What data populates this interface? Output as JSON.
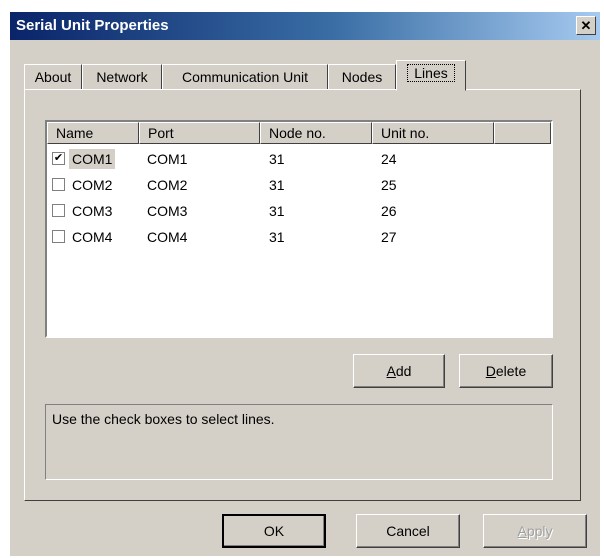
{
  "window": {
    "title": "Serial Unit Properties",
    "close_glyph": "✕"
  },
  "tabs": [
    {
      "label": "About"
    },
    {
      "label": "Network"
    },
    {
      "label": "Communication Unit"
    },
    {
      "label": "Nodes"
    },
    {
      "label": "Lines",
      "active": true
    }
  ],
  "list": {
    "columns": [
      "Name",
      "Port",
      "Node no.",
      "Unit no."
    ],
    "rows": [
      {
        "name": "COM1",
        "port": "COM1",
        "node": "31",
        "unit": "24",
        "checked": true,
        "check_glyph": "✔"
      },
      {
        "name": "COM2",
        "port": "COM2",
        "node": "31",
        "unit": "25",
        "checked": false,
        "check_glyph": ""
      },
      {
        "name": "COM3",
        "port": "COM3",
        "node": "31",
        "unit": "26",
        "checked": false,
        "check_glyph": ""
      },
      {
        "name": "COM4",
        "port": "COM4",
        "node": "31",
        "unit": "27",
        "checked": false,
        "check_glyph": ""
      }
    ]
  },
  "buttons": {
    "add_hotkey": "A",
    "add_rest": "dd",
    "delete_hotkey": "D",
    "delete_rest": "elete"
  },
  "info": {
    "text": "Use the check boxes to select lines."
  },
  "footer": {
    "ok": "OK",
    "cancel": "Cancel",
    "apply_hotkey": "A",
    "apply_rest": "pply"
  },
  "colors": {
    "title_start": "#0a246a",
    "title_end": "#a6caf0",
    "face": "#d4d0c8"
  }
}
